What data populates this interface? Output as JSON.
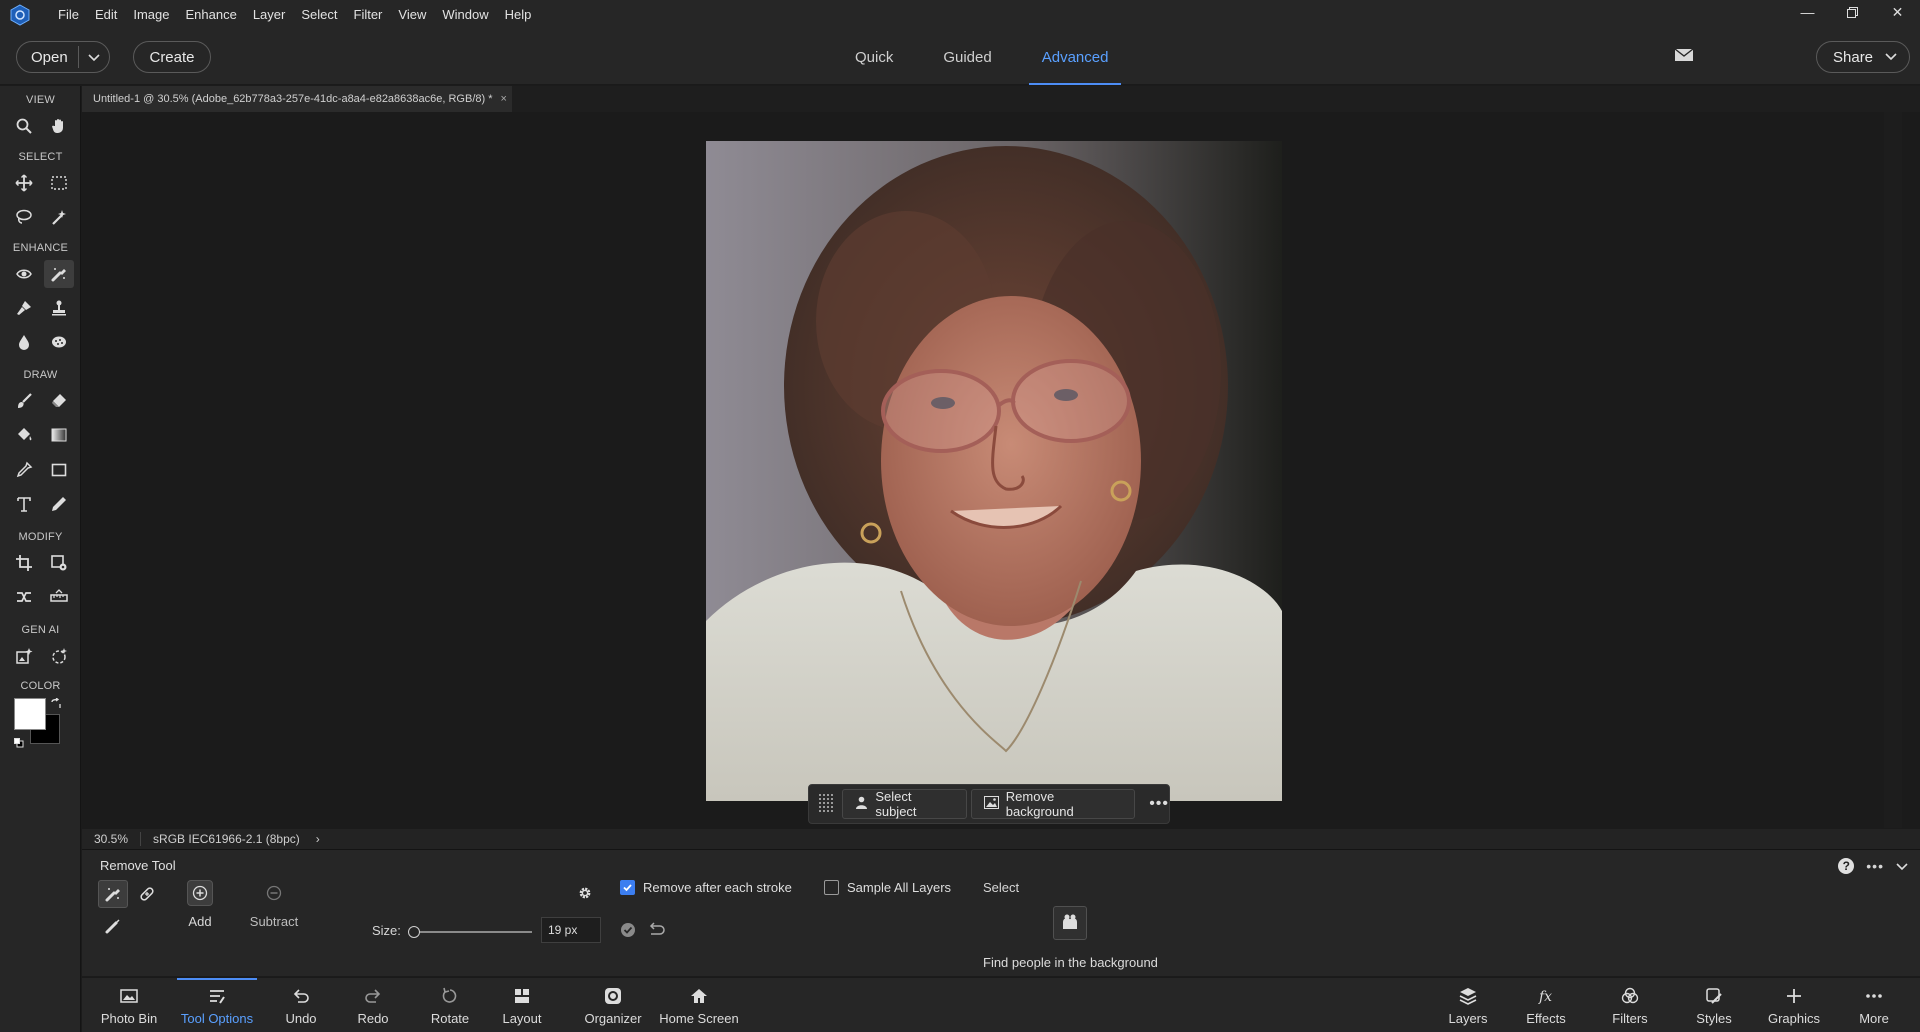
{
  "menubar": {
    "items": [
      "File",
      "Edit",
      "Image",
      "Enhance",
      "Layer",
      "Select",
      "Filter",
      "View",
      "Window",
      "Help"
    ]
  },
  "topbar": {
    "open_label": "Open",
    "create_label": "Create",
    "modes": [
      "Quick",
      "Guided",
      "Advanced"
    ],
    "active_mode": "Advanced",
    "share_label": "Share"
  },
  "toolbox": {
    "sections": [
      "VIEW",
      "SELECT",
      "ENHANCE",
      "DRAW",
      "MODIFY",
      "GEN AI",
      "COLOR"
    ],
    "foreground_color": "#ffffff",
    "background_color": "#000000"
  },
  "document": {
    "tab_title": "Untitled-1 @ 30.5% (Adobe_62b778a3-257e-41dc-a8a4-e82a8638ac6e, RGB/8) *"
  },
  "floatbar": {
    "select_subject": "Select subject",
    "remove_background": "Remove background"
  },
  "status": {
    "zoom": "30.5%",
    "profile": "sRGB IEC61966-2.1 (8bpc)"
  },
  "tool_options": {
    "title": "Remove Tool",
    "add_label": "Add",
    "subtract_label": "Subtract",
    "size_label": "Size:",
    "size_value": "19 px",
    "remove_after_stroke": "Remove after each stroke",
    "remove_after_stroke_checked": true,
    "sample_all_layers": "Sample All Layers",
    "sample_all_layers_checked": false,
    "select_label": "Select",
    "find_people": "Find people in the background"
  },
  "taskbar": {
    "left": [
      "Photo Bin",
      "Tool Options",
      "Undo",
      "Redo",
      "Rotate",
      "Layout",
      "Organizer",
      "Home Screen"
    ],
    "right": [
      "Layers",
      "Effects",
      "Filters",
      "Styles",
      "Graphics",
      "More"
    ],
    "active": "Tool Options"
  },
  "colors": {
    "accent": "#4d8df5",
    "checkbox_on": "#3c7ef0"
  }
}
